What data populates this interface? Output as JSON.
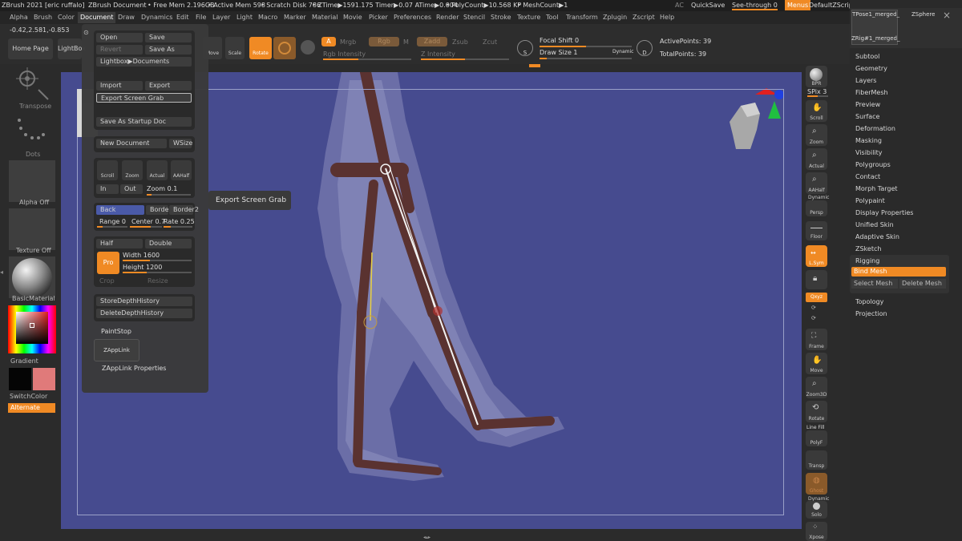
{
  "titlebar": {
    "app": "ZBrush 2021 [eric ruffalo]",
    "doc": "ZBrush Document",
    "free_mem": "• Free Mem 2.196GB",
    "active_mem": "• Active Mem 598",
    "scratch": "• Scratch Disk 786",
    "ztime": "• ZTime▶1591.175 Timer▶0.07 ATime▶0.004",
    "polycount": "• PolyCount▶10.568 KP",
    "meshcount": "• MeshCount▶1",
    "ac": "AC",
    "quicksave": "QuickSave",
    "seethrough": "See-through  0",
    "menus": "Menus",
    "defaultzscript": "DefaultZScript"
  },
  "menubar": [
    "Alpha",
    "Brush",
    "Color",
    "Document",
    "Draw",
    "Dynamics",
    "Edit",
    "File",
    "Layer",
    "Light",
    "Macro",
    "Marker",
    "Material",
    "Movie",
    "Picker",
    "Preferences",
    "Render",
    "Stencil",
    "Stroke",
    "Texture",
    "Tool",
    "Transform",
    "Zplugin",
    "Zscript",
    "Help"
  ],
  "coords": "-0.42,2.581,-0.853",
  "toolbar": {
    "home_page": "Home Page",
    "lightbox": "LightBox",
    "move": "Move",
    "scale": "Scale",
    "rotate": "Rotate",
    "a": "A",
    "mrgb": "Mrgb",
    "rgb": "Rgb",
    "m": "M",
    "zadd": "Zadd",
    "zsub": "Zsub",
    "zcut": "Zcut",
    "rgb_intensity": "Rgb Intensity",
    "z_intensity": "Z Intensity",
    "s": "S",
    "focal_shift": "Focal Shift 0",
    "draw_size": "Draw Size 1",
    "dynamic": "Dynamic",
    "d": "D",
    "active_points": "ActivePoints: 39",
    "total_points": "TotalPoints: 39"
  },
  "leftshelf": {
    "transpose": "Transpose",
    "dots": "Dots",
    "alpha_off": "Alpha Off",
    "texture_off": "Texture Off",
    "material": "BasicMaterial",
    "gradient": "Gradient",
    "switchcolor": "SwitchColor",
    "alternate": "Alternate"
  },
  "docmenu": {
    "open": "Open",
    "save": "Save",
    "revert": "Revert",
    "save_as": "Save As",
    "lightbox_docs": "Lightbox▶Documents",
    "import": "Import",
    "export": "Export",
    "export_screen_grab": "Export Screen Grab",
    "save_startup": "Save As Startup Doc",
    "new_document": "New Document",
    "wsize": "WSize",
    "scroll": "Scroll",
    "zoom": "Zoom",
    "actual": "Actual",
    "aahalf": "AAHalf",
    "in": "In",
    "out": "Out",
    "zoom_val": "Zoom 0.1",
    "back": "Back",
    "border": "Border",
    "border2": "Border2",
    "range": "Range 0",
    "center": "Center 0.7",
    "rate": "Rate 0.25",
    "half": "Half",
    "double": "Double",
    "pro": "Pro",
    "width": "Width 1600",
    "height": "Height 1200",
    "crop": "Crop",
    "resize": "Resize",
    "store_depth": "StoreDepthHistory",
    "delete_depth": "DeleteDepthHistory",
    "paintstop": "PaintStop",
    "zapplink": "ZAppLink",
    "zapplink_props": "ZAppLink Properties"
  },
  "tooltip": "Export Screen Grab",
  "rightshelf": {
    "bpr": "BPR",
    "spix": "SPix 3",
    "scroll": "Scroll",
    "zoom": "Zoom",
    "actual": "Actual",
    "aahalf": "AAHalf",
    "dynamic": "Dynamic",
    "persp": "Persp",
    "floor": "Floor",
    "lsym": "L.Sym",
    "xyz": "Qxyz",
    "frame": "Frame",
    "move": "Move",
    "zoom3d": "Zoom3D",
    "rotate": "Rotate",
    "linefill": "Line Fill",
    "polyf": "PolyF",
    "transp": "Transp",
    "ghost": "Ghost",
    "dynamic2": "Dynamic",
    "solo": "Solo",
    "xpose": "Xpose"
  },
  "palette": {
    "tpose": "TPose1_merged_",
    "zsphere": "ZSphere",
    "zrig": "ZRig#1_merged_",
    "items": [
      "Subtool",
      "Geometry",
      "Layers",
      "FiberMesh",
      "Preview",
      "Surface",
      "Deformation",
      "Masking",
      "Visibility",
      "Polygroups",
      "Contact",
      "Morph Target",
      "Polypaint",
      "Display Properties",
      "Unified Skin",
      "Adaptive Skin",
      "ZSketch"
    ],
    "rigging": "Rigging",
    "bind_mesh": "Bind Mesh",
    "select_mesh": "Select Mesh",
    "delete_mesh": "Delete Mesh",
    "topology": "Topology",
    "projection": "Projection"
  },
  "colors": {
    "accent": "#f08a24",
    "canvas": "#464b8f",
    "panel": "#2b2b2b"
  }
}
